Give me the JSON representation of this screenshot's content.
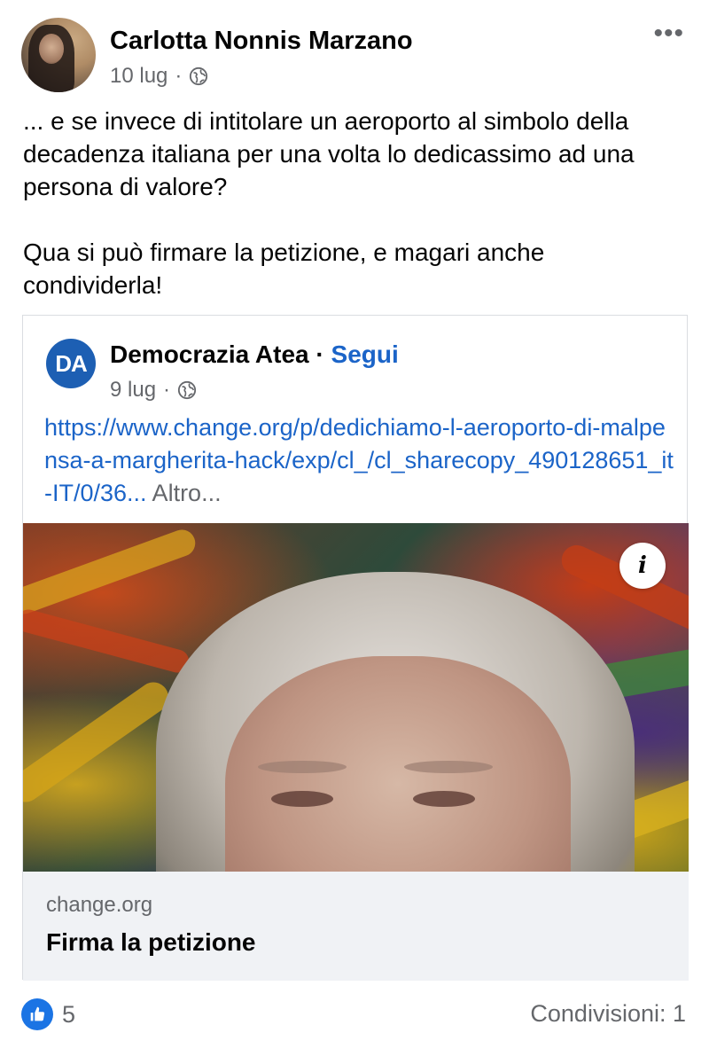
{
  "post": {
    "author": "Carlotta Nonnis Marzano",
    "date": "10 lug",
    "separator": "·",
    "text_lines": [
      "... e se invece di intitolare un aeroporto al simbolo della decadenza italiana per una volta lo dedicassimo ad una persona di valore?",
      "Qua si può firmare la petizione, e magari anche condividerla!"
    ]
  },
  "shared": {
    "logo_text": "DA",
    "page_name": "Democrazia Atea",
    "separator": "·",
    "follow_label": "Segui",
    "date": "9 lug",
    "link": "https://www.change.org/p/dedichiamo-l-aeroporto-di-malpensa-a-margherita-hack/exp/cl_/cl_sharecopy_490128651_it-IT/0/36...",
    "more_label": " Altro...",
    "info_label": "i",
    "domain": "change.org",
    "cta": "Firma la petizione"
  },
  "footer": {
    "like_count": "5",
    "shares": "Condivisioni: 1"
  },
  "colors": {
    "link_blue": "#1b64c8",
    "like_blue": "#1b74e4",
    "secondary_text": "#65676b",
    "card_footer_bg": "#f0f2f5",
    "logo_bg": "#1d5fb3"
  },
  "icons": [
    "globe-icon",
    "more-options-icon",
    "info-icon",
    "like-icon"
  ]
}
